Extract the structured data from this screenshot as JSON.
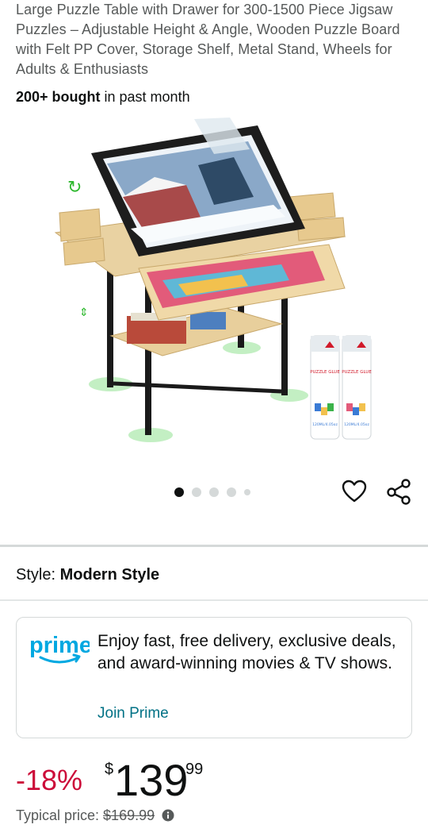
{
  "product": {
    "title": "Large Puzzle Table with Drawer for 300-1500 Piece Jigsaw Puzzles – Adjustable Height & Angle, Wooden Puzzle Board with Felt PP Cover, Storage Shelf, Metal Stand, Wheels for Adults & Enthusiasts",
    "bought_bold": "200+ bought",
    "bought_rest": " in past month"
  },
  "gallery": {
    "image_count": 5,
    "active_index": 0,
    "glue_label_1": "PUZZLE GLUE",
    "glue_label_2": "PUZZLE GLUE",
    "glue_volume_1": "120ML/4.05oz",
    "glue_volume_2": "120ML/4.05oz",
    "icons": [
      "heart-icon",
      "share-icon"
    ]
  },
  "style": {
    "label": "Style:",
    "value": "Modern Style"
  },
  "prime": {
    "logo_text": "prime",
    "message": "Enjoy fast, free delivery, exclusive deals, and award-winning movies & TV shows.",
    "join_label": "Join Prime",
    "logo_color": "#00a8e1",
    "link_color": "#007185"
  },
  "price": {
    "discount": "-18%",
    "currency": "$",
    "whole": "139",
    "fraction": "99",
    "typical_label": "Typical price: ",
    "typical_value": "$169.99",
    "discount_color": "#cc0c39"
  }
}
